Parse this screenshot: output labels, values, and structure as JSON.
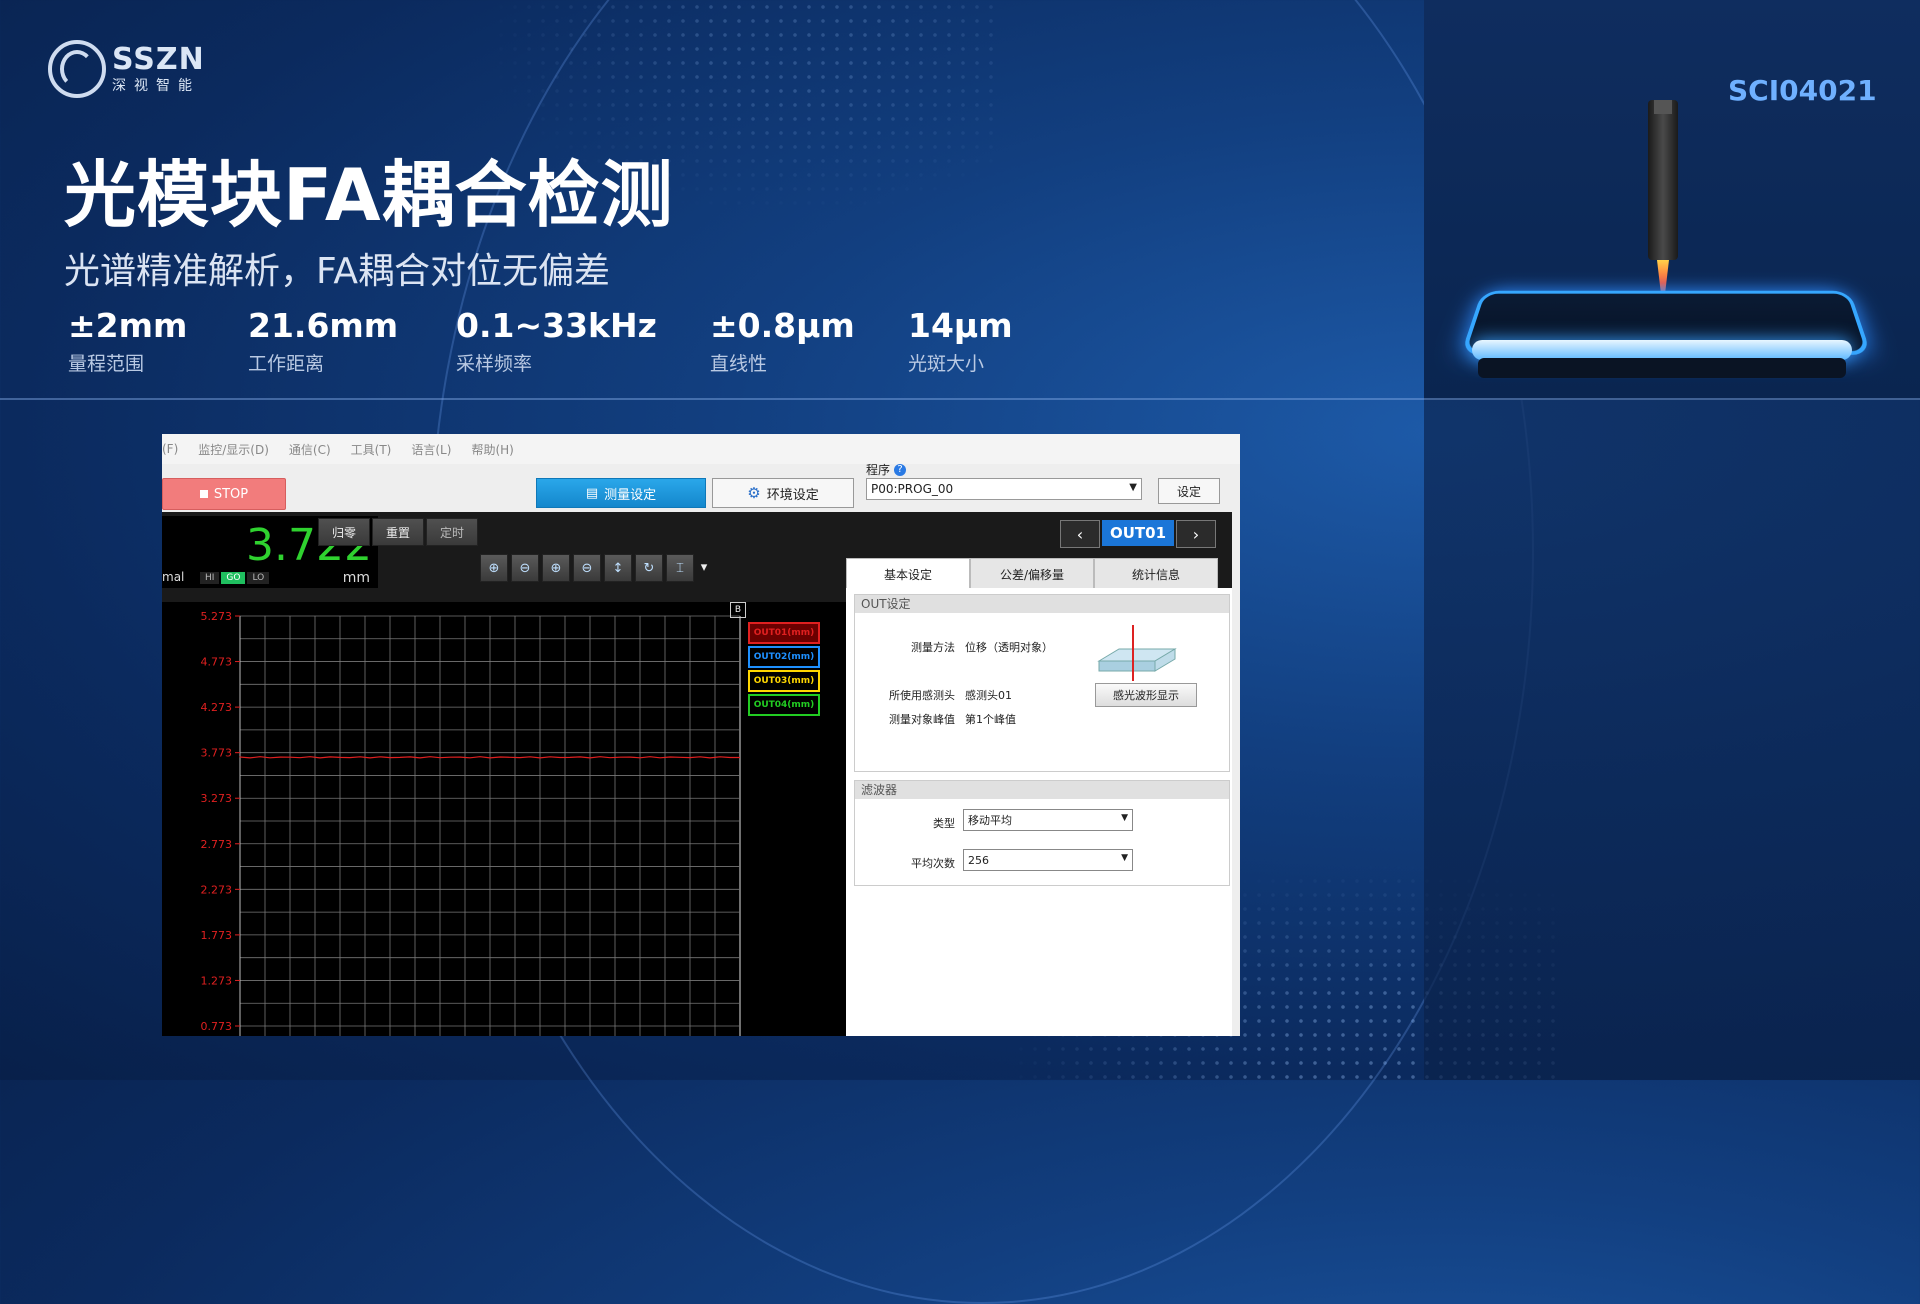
{
  "brand": {
    "name_en": "SSZN",
    "name_cn": "深视智能"
  },
  "hero": {
    "title": "光模块FA耦合检测",
    "subtitle": "光谱精准解析，FA耦合对位无偏差",
    "specs": [
      {
        "value": "±2mm",
        "label": "量程范围"
      },
      {
        "value": "21.6mm",
        "label": "工作距离"
      },
      {
        "value": "0.1~33kHz",
        "label": "采样频率"
      },
      {
        "value": "±0.8μm",
        "label": "直线性"
      },
      {
        "value": "14μm",
        "label": "光斑大小"
      }
    ],
    "model": "SCI04021"
  },
  "app": {
    "menu": [
      "(F)",
      "监控/显示(D)",
      "通信(C)",
      "工具(T)",
      "语言(L)",
      "帮助(H)"
    ],
    "stop_label": "STOP",
    "measure_settings_label": "测量设定",
    "env_settings_label": "环境设定",
    "program_label": "程序",
    "program_value": "P00:PROG_00",
    "set_label": "设定",
    "reading": "3.722",
    "reading_unit": "mm",
    "mode_text": "mal",
    "judgement": [
      "HI",
      "GO",
      "LO"
    ],
    "toolbar": {
      "zero": "归零",
      "reset": "重置",
      "timer": "定时"
    },
    "output_current": "OUT01",
    "tabs": [
      "基本设定",
      "公差/偏移量",
      "统计信息"
    ],
    "out_group": {
      "header": "OUT设定",
      "method_label": "测量方法",
      "method_value": "位移（透明对象）",
      "head_label": "所使用感测头",
      "head_value": "感测头01",
      "peak_label": "测量对象峰值",
      "peak_value": "第1个峰值",
      "wave_button": "感光波形显示"
    },
    "filter_group": {
      "header": "滤波器",
      "type_label": "类型",
      "type_value": "移动平均",
      "avg_label": "平均次数",
      "avg_value": "256"
    }
  },
  "chart_data": {
    "type": "line",
    "y_ticks": [
      "5.273",
      "4.773",
      "4.273",
      "3.773",
      "3.273",
      "2.773",
      "2.273",
      "1.773",
      "1.273",
      "0.773"
    ],
    "ylim": [
      0.773,
      5.273
    ],
    "grid": true,
    "series": [
      {
        "name": "OUT01(mm)",
        "color": "#e02020",
        "value": 3.722
      },
      {
        "name": "OUT02(mm)",
        "color": "#1e90ff"
      },
      {
        "name": "OUT03(mm)",
        "color": "#ffd700"
      },
      {
        "name": "OUT04(mm)",
        "color": "#22cc22"
      }
    ],
    "legend_position": "right",
    "marker_label": "B"
  }
}
